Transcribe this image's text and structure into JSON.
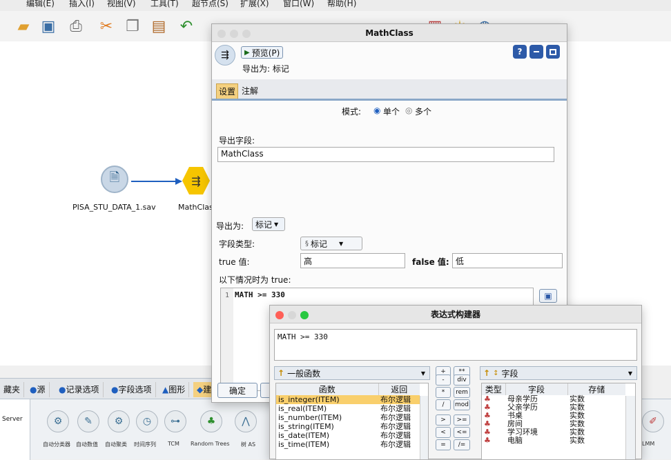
{
  "menubar": {
    "items": [
      "编辑(E)",
      "插入(I)",
      "视图(V)",
      "工具(T)",
      "超节点(S)",
      "扩展(X)",
      "窗口(W)",
      "帮助(H)"
    ]
  },
  "canvas": {
    "source_node": {
      "label": "PISA_STU_DATA_1.sav",
      "icon": "sav-file-icon"
    },
    "derive_node": {
      "label": "MathClass",
      "icon": "derive-node-icon"
    }
  },
  "palette": {
    "tabs": [
      "藏夹",
      "源",
      "记录选项",
      "字段选项",
      "图形",
      "建模"
    ],
    "left_item": "Server",
    "nodes": [
      "自动分类器",
      "自动数值",
      "自动聚类",
      "时间序列",
      "TCM",
      "Random Trees",
      "树 AS"
    ],
    "right_label": "LMM"
  },
  "derive_dialog": {
    "title": "MathClass",
    "preview_button": "预览(P)",
    "derive_as_text": "导出为: 标记",
    "tabs": [
      "设置",
      "注解"
    ],
    "mode_label": "模式:",
    "mode_single": "单个",
    "mode_multi": "多个",
    "derive_field_label": "导出字段:",
    "derive_field_value": "MathClass",
    "derive_as_label": "导出为:",
    "derive_as_value": "标记",
    "field_type_label": "字段类型:",
    "field_type_value": "标记",
    "true_label": "true 值:",
    "true_value": "高",
    "false_label": "false 值:",
    "false_value": "低",
    "condition_label": "以下情况时为 true:",
    "condition_line_no": "1",
    "condition_code": "MATH >= 330",
    "ok_button": "确定"
  },
  "expr_builder": {
    "title": "表达式构建器",
    "expression": "MATH >= 330",
    "func_category": "一般函数",
    "func_headers": [
      "函数",
      "返回"
    ],
    "functions": [
      {
        "name": "is_integer(ITEM)",
        "ret": "布尔逻辑"
      },
      {
        "name": "is_real(ITEM)",
        "ret": "布尔逻辑"
      },
      {
        "name": "is_number(ITEM)",
        "ret": "布尔逻辑"
      },
      {
        "name": "is_string(ITEM)",
        "ret": "布尔逻辑"
      },
      {
        "name": "is_date(ITEM)",
        "ret": "布尔逻辑"
      },
      {
        "name": "is_time(ITEM)",
        "ret": "布尔逻辑"
      }
    ],
    "operators": [
      [
        "+",
        "**"
      ],
      [
        "-",
        "div"
      ],
      [
        "*",
        "rem"
      ],
      [
        "/",
        "mod"
      ],
      [
        ">",
        ">="
      ],
      [
        "<",
        "<="
      ],
      [
        "=",
        "/="
      ]
    ],
    "field_dropdown": "字段",
    "field_headers": [
      "类型",
      "字段",
      "存储"
    ],
    "fields": [
      {
        "name": "母亲学历",
        "storage": "实数"
      },
      {
        "name": "父亲学历",
        "storage": "实数"
      },
      {
        "name": "书桌",
        "storage": "实数"
      },
      {
        "name": "房间",
        "storage": "实数"
      },
      {
        "name": "学习环境",
        "storage": "实数"
      },
      {
        "name": "电脑",
        "storage": "实数"
      }
    ]
  },
  "colors": {
    "accent": "#2b6cc4",
    "selected_row": "#f9cf6c",
    "tab_active": "#f4d080",
    "node_yellow": "#f6c500"
  }
}
